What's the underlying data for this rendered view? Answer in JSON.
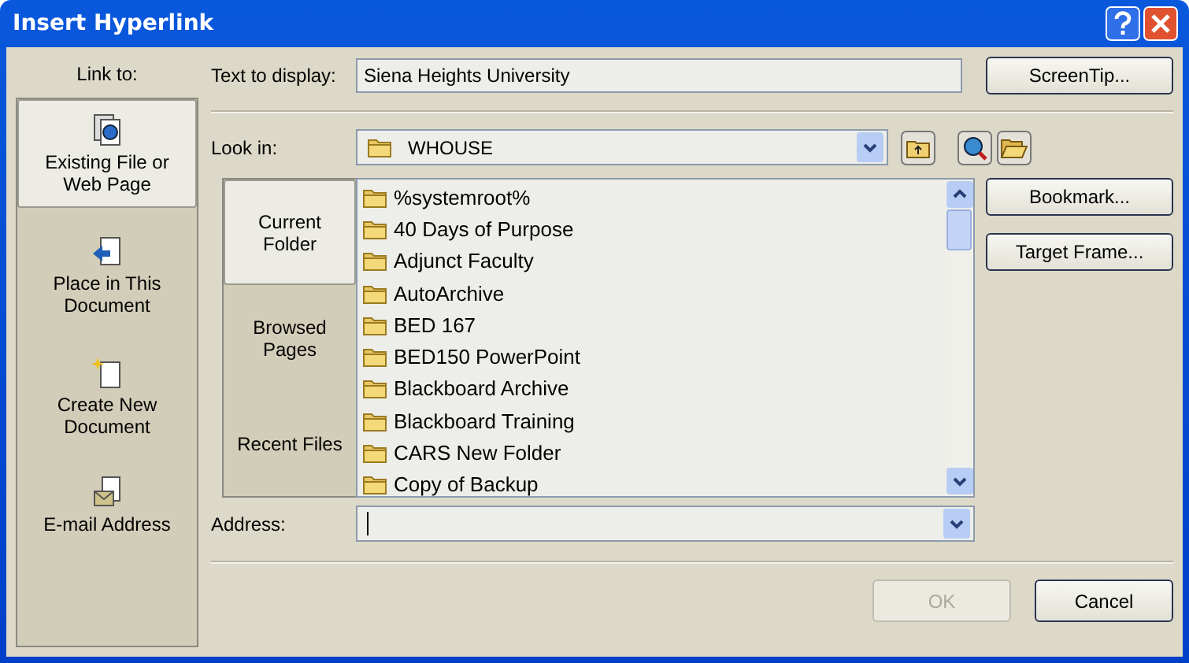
{
  "window": {
    "title": "Insert Hyperlink"
  },
  "link_to": {
    "label": "Link to:",
    "items": [
      {
        "kind": "file",
        "label": "Existing File or Web Page",
        "selected": true
      },
      {
        "kind": "place",
        "label": "Place in This Document",
        "selected": false
      },
      {
        "kind": "new",
        "label": "Create New Document",
        "selected": false
      },
      {
        "kind": "email",
        "label": "E-mail Address",
        "selected": false
      }
    ]
  },
  "text_to_display": {
    "label": "Text to display:",
    "value": "Siena Heights University"
  },
  "look_in": {
    "label": "Look in:",
    "value": "WHOUSE"
  },
  "views": [
    {
      "label": "Current Folder",
      "selected": true
    },
    {
      "label": "Browsed Pages",
      "selected": false
    },
    {
      "label": "Recent Files",
      "selected": false
    }
  ],
  "files": [
    "%systemroot%",
    "40 Days of Purpose",
    "Adjunct Faculty",
    "AutoArchive",
    "BED 167",
    "BED150 PowerPoint",
    "Blackboard Archive",
    "Blackboard Training",
    "CARS New Folder",
    "Copy of Backup"
  ],
  "address": {
    "label": "Address:"
  },
  "side_buttons": [
    "ScreenTip...",
    "Bookmark...",
    "Target Frame..."
  ],
  "buttons": [
    {
      "label": "OK",
      "disabled": true
    },
    {
      "label": "Cancel",
      "disabled": false
    }
  ]
}
